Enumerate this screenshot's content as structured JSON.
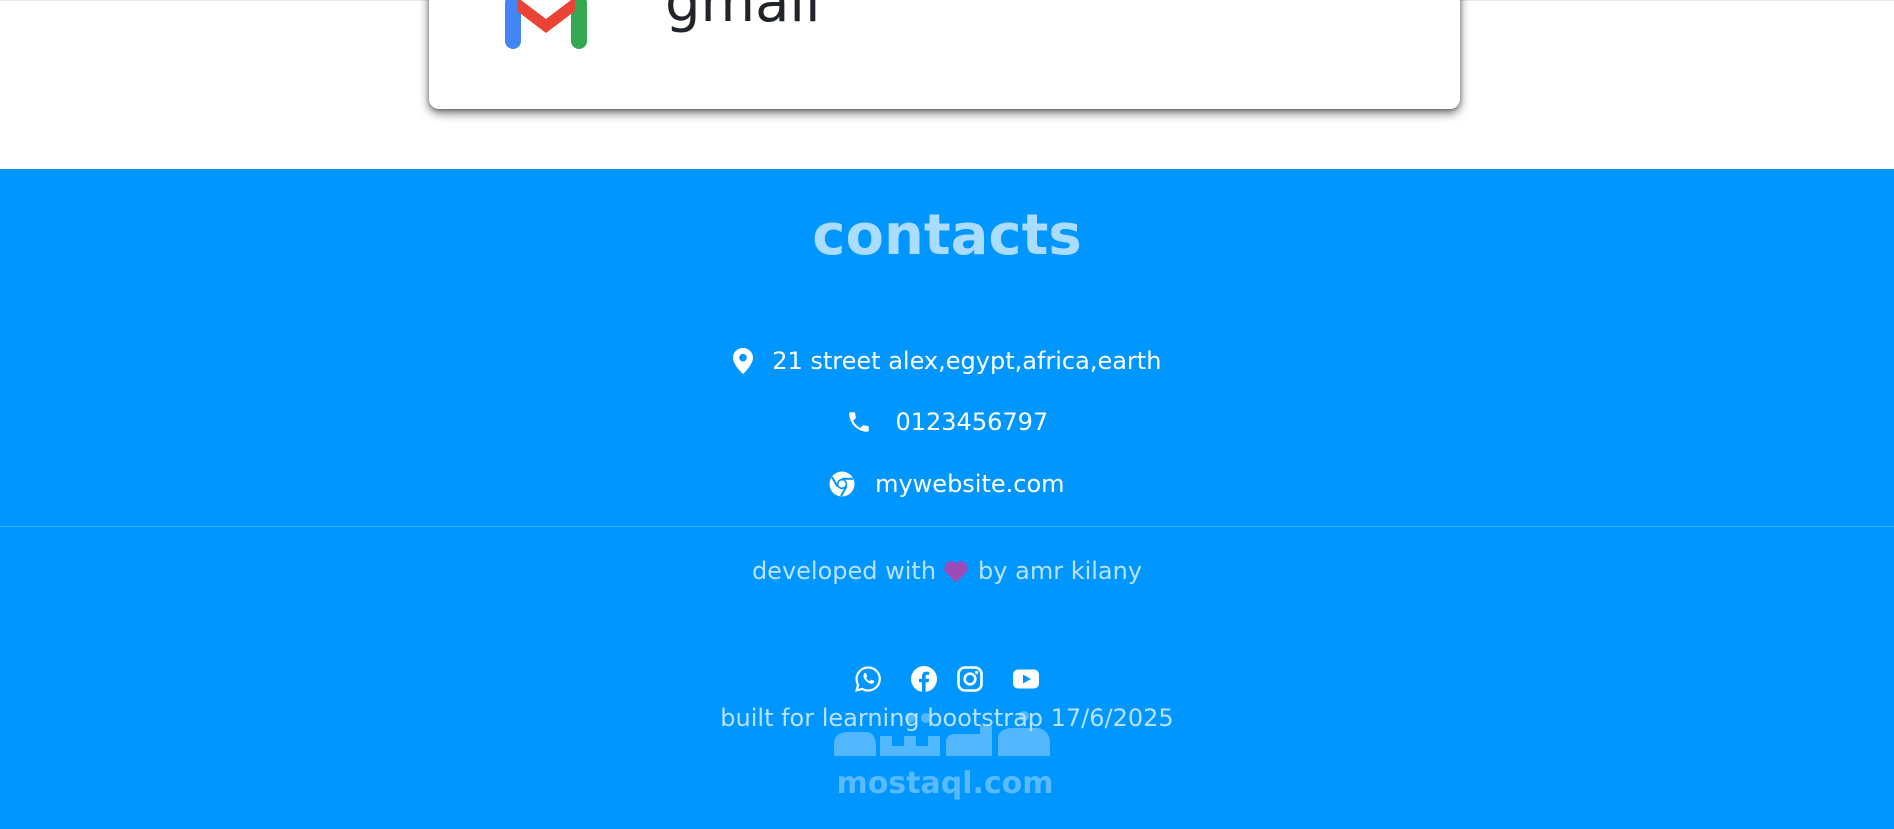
{
  "card": {
    "title": "gmail",
    "logo_icon": "gmail-logo-icon"
  },
  "footer": {
    "title": "contacts",
    "background_color": "#0096ff",
    "contacts": [
      {
        "icon": "location-pin-icon",
        "text": "21 street alex,egypt,africa,earth"
      },
      {
        "icon": "phone-icon",
        "text": "0123456797"
      },
      {
        "icon": "chrome-icon",
        "text": "mywebsite.com"
      }
    ],
    "developed_prefix": "developed with",
    "developed_icon": "heart-icon",
    "developed_suffix": "by amr kilany",
    "socials": [
      "whatsapp-icon",
      "facebook-icon",
      "instagram-icon",
      "youtube-icon"
    ],
    "built_text": "built for learning bootstrap 17/6/2025"
  },
  "watermark": {
    "arabic": "مستقل",
    "latin": "mostaql.com"
  }
}
